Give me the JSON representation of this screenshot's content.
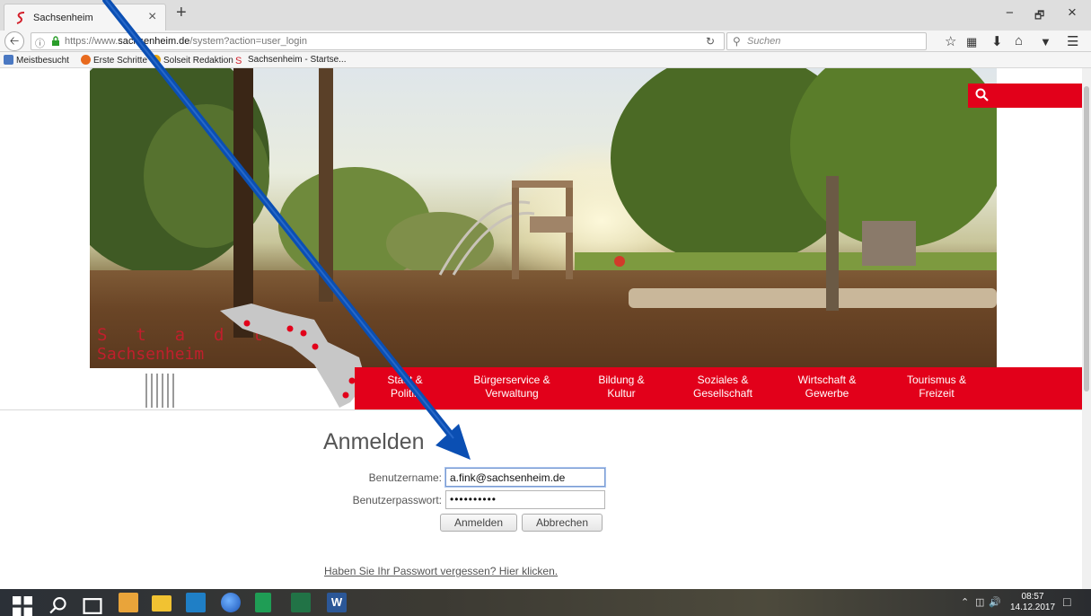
{
  "browser": {
    "tab_title": "Sachsenheim",
    "tab_close": "×",
    "new_tab": "+",
    "window_controls": {
      "minimize": "−",
      "restore": "🗗",
      "close": "×"
    },
    "url_prefix": "https://www.",
    "url_domain": "sachsenheim.de",
    "url_path": "/system?action=user_login",
    "search_placeholder": "Suchen",
    "icons": [
      "back-icon",
      "info-icon",
      "lock-icon",
      "reload-icon",
      "search-icon",
      "bookmark-star-icon",
      "library-icon",
      "download-icon",
      "home-icon",
      "pocket-icon",
      "menu-icon"
    ],
    "bookmarks": [
      {
        "label": "Meistbesucht",
        "color": "#4a78c2"
      },
      {
        "label": "Erste Schritte",
        "color": "#e86a1e"
      },
      {
        "label": "Solseit Redaktion",
        "color": "#e5a30c"
      },
      {
        "label": "Sachsenheim - Startse...",
        "color": "#d3202b"
      }
    ]
  },
  "site": {
    "logo_word1": "S  t  a  d  t",
    "logo_word2": "Sachsenheim",
    "accent_color": "#e2001a",
    "nav": [
      {
        "line1": "Stadt &",
        "line2": "Politik"
      },
      {
        "line1": "Bürgerservice &",
        "line2": "Verwaltung"
      },
      {
        "line1": "Bildung &",
        "line2": "Kultur"
      },
      {
        "line1": "Soziales &",
        "line2": "Gesellschaft"
      },
      {
        "line1": "Wirtschaft &",
        "line2": "Gewerbe"
      },
      {
        "line1": "Tourismus &",
        "line2": "Freizeit"
      }
    ]
  },
  "login": {
    "title": "Anmelden",
    "username_label": "Benutzername:",
    "username_value": "a.fink@sachsenheim.de",
    "password_label": "Benutzerpasswort:",
    "password_value": "••••••••••",
    "submit_label": "Anmelden",
    "cancel_label": "Abbrechen",
    "forgot_link": "Haben Sie Ihr Passwort vergessen? Hier klicken."
  },
  "taskbar": {
    "time": "08:57",
    "date": "14.12.2017",
    "apps": [
      "windows-start-icon",
      "search-icon",
      "task-view-icon",
      "outlook-icon",
      "file-explorer-icon",
      "dynamics-icon",
      "firefox-icon",
      "project-icon",
      "excel-icon",
      "word-icon"
    ]
  }
}
